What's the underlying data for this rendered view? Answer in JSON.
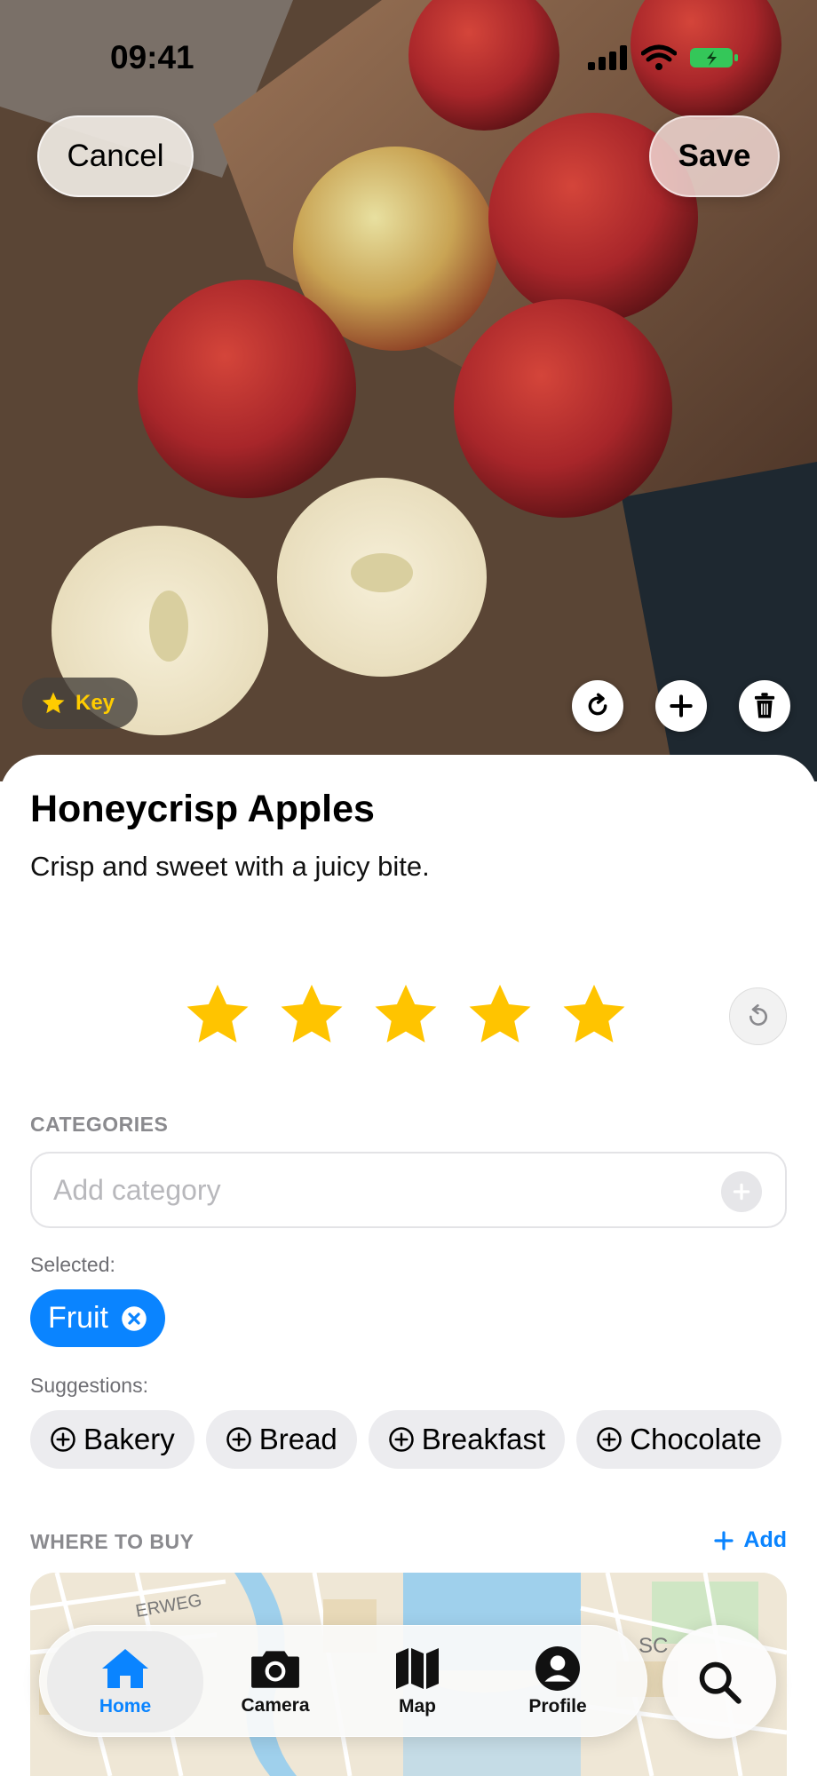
{
  "status_bar": {
    "time": "09:41"
  },
  "header": {
    "cancel_label": "Cancel",
    "save_label": "Save"
  },
  "photo": {
    "badge_label": "Key"
  },
  "item": {
    "title": "Honeycrisp Apples",
    "description": "Crisp and sweet with a juicy bite.",
    "rating": 5,
    "rating_max": 5
  },
  "categories": {
    "section_label": "CATEGORIES",
    "input_placeholder": "Add category",
    "selected_label": "Selected:",
    "selected": [
      {
        "label": "Fruit"
      }
    ],
    "suggestions_label": "Suggestions:",
    "suggestions": [
      {
        "label": "Bakery"
      },
      {
        "label": "Bread"
      },
      {
        "label": "Breakfast"
      },
      {
        "label": "Chocolate"
      }
    ]
  },
  "where_to_buy": {
    "section_label": "WHERE TO BUY",
    "add_label": "Add"
  },
  "map": {
    "labels": [
      "ERWEG",
      "SC"
    ]
  },
  "tab_bar": {
    "tabs": [
      {
        "label": "Home",
        "icon": "house-icon",
        "active": true
      },
      {
        "label": "Camera",
        "icon": "camera-icon",
        "active": false
      },
      {
        "label": "Map",
        "icon": "map-icon",
        "active": false
      },
      {
        "label": "Profile",
        "icon": "person-icon",
        "active": false
      }
    ],
    "search_icon": "magnifying-glass-icon"
  },
  "colors": {
    "accent": "#0A84FF",
    "star": "#FFC400",
    "battery": "#34C759"
  }
}
